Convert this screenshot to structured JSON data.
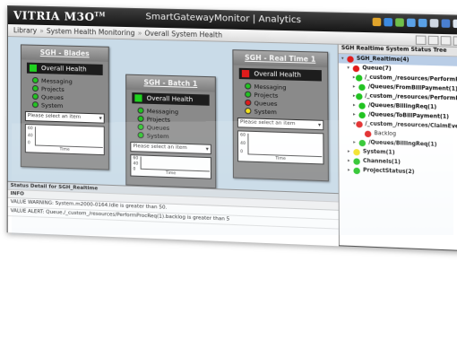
{
  "app": {
    "brand": "VITRIA",
    "product": "M3O",
    "trademark": "TM",
    "title": "SmartGatewayMonitor | Analytics"
  },
  "breadcrumb": [
    "Library",
    "System Health Monitoring",
    "Overall System Health"
  ],
  "cards": [
    {
      "title": "SGH - Blades",
      "health_label": "Overall Health",
      "health_color": "#1fd21f",
      "metrics": [
        {
          "label": "Messaging",
          "color": "#22c322"
        },
        {
          "label": "Projects",
          "color": "#22c322"
        },
        {
          "label": "Queues",
          "color": "#22c322"
        },
        {
          "label": "System",
          "color": "#22c322"
        }
      ],
      "select_placeholder": "Please select an item",
      "chart_xlabel": "Time",
      "chart_yticks": [
        "60",
        "40",
        "0"
      ]
    },
    {
      "title": "SGH - Batch 1",
      "health_label": "Overall Health",
      "health_color": "#1fd21f",
      "metrics": [
        {
          "label": "Messaging",
          "color": "#22c322"
        },
        {
          "label": "Projects",
          "color": "#22c322"
        },
        {
          "label": "Queues",
          "color": "#22c322"
        },
        {
          "label": "System",
          "color": "#22c322"
        }
      ],
      "select_placeholder": "Please select an item",
      "chart_xlabel": "Time",
      "chart_yticks": [
        "60",
        "40",
        "0"
      ]
    },
    {
      "title": "SGH - Real Time 1",
      "health_label": "Overall Health",
      "health_color": "#e01b1b",
      "metrics": [
        {
          "label": "Messaging",
          "color": "#22c322"
        },
        {
          "label": "Projects",
          "color": "#22c322"
        },
        {
          "label": "Queues",
          "color": "#e01b1b"
        },
        {
          "label": "System",
          "color": "#f3e21c"
        }
      ],
      "select_placeholder": "Please select an item",
      "chart_xlabel": "Time",
      "chart_yticks": [
        "60",
        "40",
        "0"
      ]
    }
  ],
  "status": {
    "title": "Status Detail for SGH_Realtime",
    "info_header": "INFO",
    "rows": [
      "VALUE WARNING: System.m2000-0164.Idle is greater than 50.",
      "VALUE ALERT: Queue./_custom_/resources/PerformProcReq(1).backlog is greater than 5"
    ]
  },
  "tree": {
    "title": "SGH Realtime System Status Tree",
    "nodes": [
      {
        "label": "SGH_Realtime(4)",
        "level": 0,
        "arrow": "▾",
        "color": "#e01b1b",
        "selected": true
      },
      {
        "label": "Queue(7)",
        "level": 1,
        "arrow": "▾",
        "color": "#e01b1b"
      },
      {
        "label": "/_custom_/resources/PerformProc",
        "level": 2,
        "arrow": "▸",
        "color": "#22c322"
      },
      {
        "label": "/Queues/FromBillPayment(1)",
        "level": 2,
        "arrow": "▸",
        "color": "#22c322"
      },
      {
        "label": "/_custom_/resources/PerformProc",
        "level": 2,
        "arrow": "▸",
        "color": "#22c322"
      },
      {
        "label": "/Queues/BillingReq(1)",
        "level": 2,
        "arrow": "▸",
        "color": "#22c322"
      },
      {
        "label": "/Queues/ToBillPayment(1)",
        "level": 2,
        "arrow": "▸",
        "color": "#22c322"
      },
      {
        "label": "/_custom_/resources/ClaimEventsL",
        "level": 2,
        "arrow": "▾",
        "color": "#e01b1b"
      },
      {
        "label": "Backlog",
        "level": 3,
        "arrow": "",
        "color": "#e01b1b",
        "plain": true
      },
      {
        "label": "/Queues/BillingReq(1)",
        "level": 2,
        "arrow": "▸",
        "color": "#22c322"
      },
      {
        "label": "System(1)",
        "level": 1,
        "arrow": "▸",
        "color": "#f3e21c"
      },
      {
        "label": "Channels(1)",
        "level": 1,
        "arrow": "▸",
        "color": "#22c322"
      },
      {
        "label": "ProjectStatus(2)",
        "level": 1,
        "arrow": "▸",
        "color": "#22c322"
      }
    ]
  }
}
